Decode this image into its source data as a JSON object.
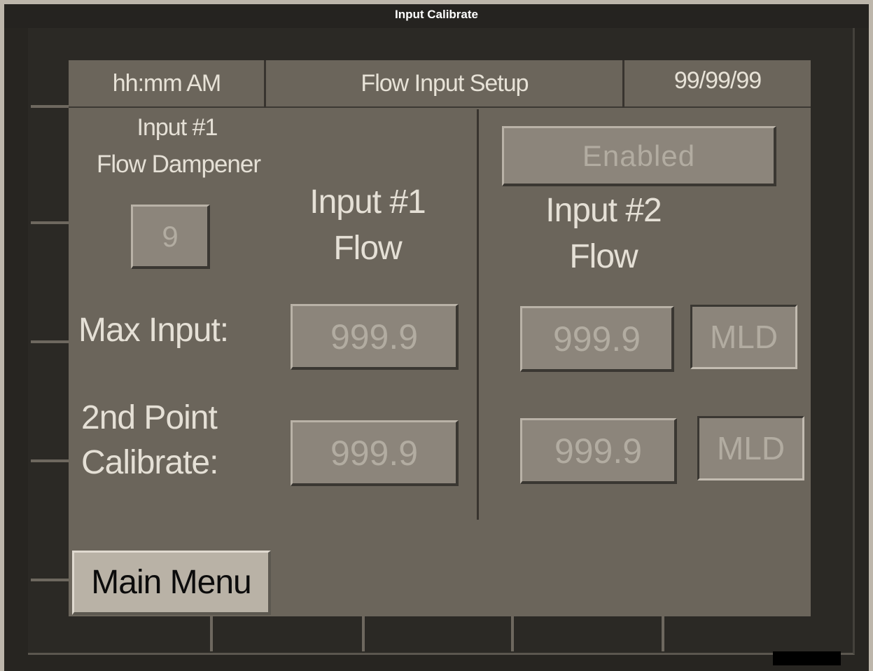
{
  "window": {
    "title": "Input Calibrate"
  },
  "header": {
    "time": "hh:mm AM",
    "title": "Flow Input Setup",
    "date": "99/99/99"
  },
  "input1": {
    "dampener_label_line1": "Input #1",
    "dampener_label_line2": "Flow Dampener",
    "dampener_value": "9",
    "flow_heading_line1": "Input #1",
    "flow_heading_line2": "Flow",
    "max_input_value": "999.9",
    "calibrate_value": "999.9"
  },
  "input2": {
    "enabled_label": "Enabled",
    "flow_heading_line1": "Input #2",
    "flow_heading_line2": "Flow",
    "max_input_value": "999.9",
    "max_input_unit": "MLD",
    "calibrate_value": "999.9",
    "calibrate_unit": "MLD"
  },
  "rows": {
    "max_input_label": "Max Input:",
    "calibrate_label_line1": "2nd Point",
    "calibrate_label_line2": "Calibrate:"
  },
  "footer": {
    "main_menu_label": "Main Menu"
  },
  "colors": {
    "panel": "#6b655b",
    "button_face": "#8c857b",
    "main_menu_face": "#b9b2a6",
    "text_light": "#e5e0d6",
    "text_disabled": "#b2aca1"
  }
}
